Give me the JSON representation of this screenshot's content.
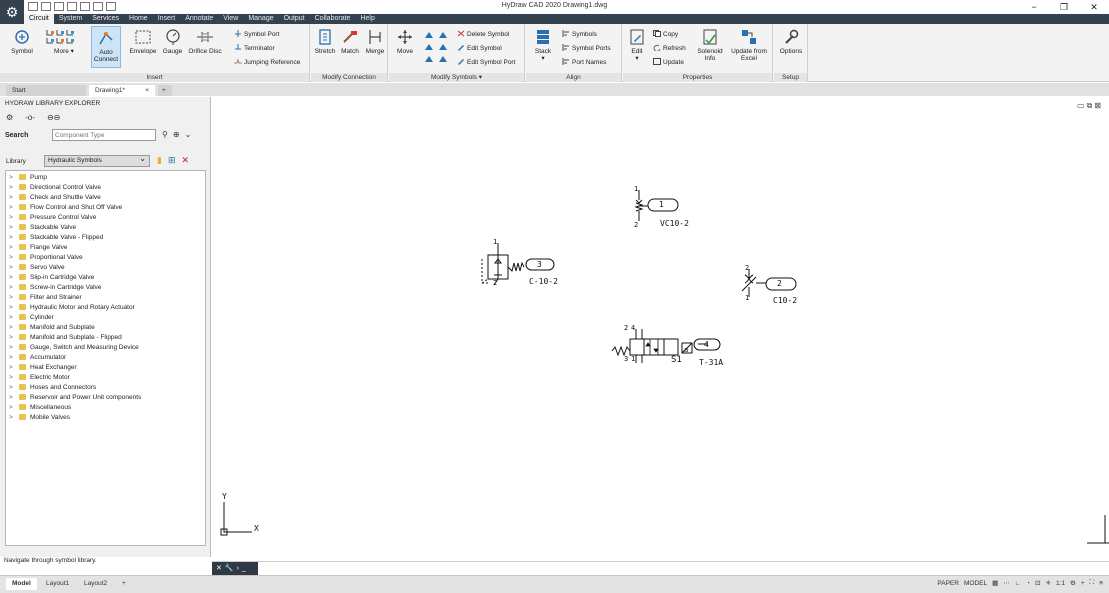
{
  "window": {
    "title": "HyDraw CAD 2020   Drawing1.dwg"
  },
  "menu_tabs": [
    "Circuit",
    "System",
    "Services",
    "Home",
    "Insert",
    "Annotate",
    "View",
    "Manage",
    "Output",
    "Collaborate",
    "Help"
  ],
  "ribbon": {
    "insert": {
      "title": "Insert",
      "symbol": "Symbol",
      "more": "More",
      "auto_connect_1": "Auto",
      "auto_connect_2": "Connect",
      "envelope": "Envelope",
      "gauge": "Gauge",
      "orifice_disc": "Orifice Disc",
      "symbol_port": "Symbol Port",
      "terminator": "Terminator",
      "jumping_reference": "Jumping Reference"
    },
    "modify_connection": {
      "title": "Modify Connection",
      "stretch": "Stretch",
      "match": "Match",
      "merge": "Merge"
    },
    "modify_symbols": {
      "title": "Modify Symbols",
      "move": "Move",
      "delete_symbol": "Delete Symbol",
      "edit_symbol": "Edit Symbol",
      "edit_symbol_port": "Edit Symbol Port"
    },
    "align": {
      "title": "Align",
      "stack": "Stack",
      "symbols": "Symbols",
      "symbol_ports": "Symbol Ports",
      "port_names": "Port Names"
    },
    "properties": {
      "title": "Properties",
      "edit": "Edit",
      "copy": "Copy",
      "refresh": "Refresh",
      "update": "Update",
      "solenoid_info_1": "Solenoid",
      "solenoid_info_2": "Info",
      "update_excel_1": "Update from",
      "update_excel_2": "Excel"
    },
    "setup": {
      "title": "Setup",
      "options": "Options"
    }
  },
  "doc_tabs": {
    "start": "Start",
    "drawing": "Drawing1*"
  },
  "explorer": {
    "title": "HYDRAW LIBRARY EXPLORER",
    "search_label": "Search",
    "search_placeholder": "Component Type",
    "library_label": "Library",
    "library_value": "Hydraulic Symbols",
    "items": [
      "Pump",
      "Directional Control Valve",
      "Check and Shuttle Valve",
      "Flow Control and Shut Off Valve",
      "Pressure Control Valve",
      "Stackable Valve",
      "Stackable Valve - Flipped",
      "Flange Valve",
      "Proportional Valve",
      "Servo Valve",
      "Slip-in Cartridge Valve",
      "Screw-in Cartridge Valve",
      "Filter and Strainer",
      "Hydraulic Motor and Rotary Actuator",
      "Cylinder",
      "Manifold and Subplate",
      "Manifold and Subplate - Flipped",
      "Gauge, Switch and Measuring Device",
      "Accumulator",
      "Heat Exchanger",
      "Electric Motor",
      "Hoses and Connectors",
      "Reservoir and Power Unit components",
      "Miscellaneous",
      "Mobile Valves"
    ],
    "status": "Navigate through symbol library."
  },
  "drawing": {
    "symbols": [
      {
        "tag": "1",
        "part": "VC10-2",
        "port_a": "1",
        "port_b": "2"
      },
      {
        "tag": "2",
        "part": "C10-2",
        "port_a": "2",
        "port_b": "1"
      },
      {
        "tag": "3",
        "part": "C-10-2",
        "port_a": "1",
        "port_b": "2"
      },
      {
        "tag": "4",
        "part": "T-31A",
        "solenoid": "S1",
        "port_a": "2",
        "port_b": "4",
        "port_c": "3",
        "port_d": "1",
        "side": "a"
      }
    ],
    "ucs_x": "X",
    "ucs_y": "Y"
  },
  "layout_tabs": [
    "Model",
    "Layout1",
    "Layout2"
  ],
  "statusbar": {
    "space": "PAPER",
    "model": "MODEL",
    "scale": "1:1"
  }
}
